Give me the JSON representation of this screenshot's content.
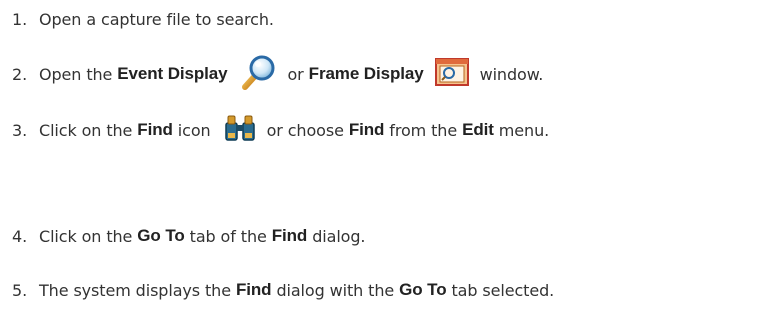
{
  "steps": [
    {
      "number": "1.",
      "text": "Open a capture file to search."
    },
    {
      "number": "2.",
      "pre": "Open the",
      "bold1": "Event Display",
      "or": "or",
      "bold2": "Frame Display",
      "post": "window.",
      "icon1": "magnifier-icon",
      "icon2": "frame-display-icon"
    },
    {
      "number": "3.",
      "pre": "Click on the",
      "bold1": "Find",
      "mid1": "icon",
      "mid2": "or choose",
      "bold2": "Find",
      "mid3": "from the",
      "bold3": "Edit",
      "post": "menu.",
      "icon": "binoculars-icon"
    },
    {
      "number": "4.",
      "pre": "Click on the",
      "bold1": "Go To",
      "mid1": "tab of the",
      "bold2": "Find",
      "post": "dialog."
    },
    {
      "number": "5.",
      "pre": "The system displays the",
      "bold1": "Find",
      "mid1": "dialog with the",
      "bold2": "Go To",
      "post": "tab selected."
    }
  ]
}
